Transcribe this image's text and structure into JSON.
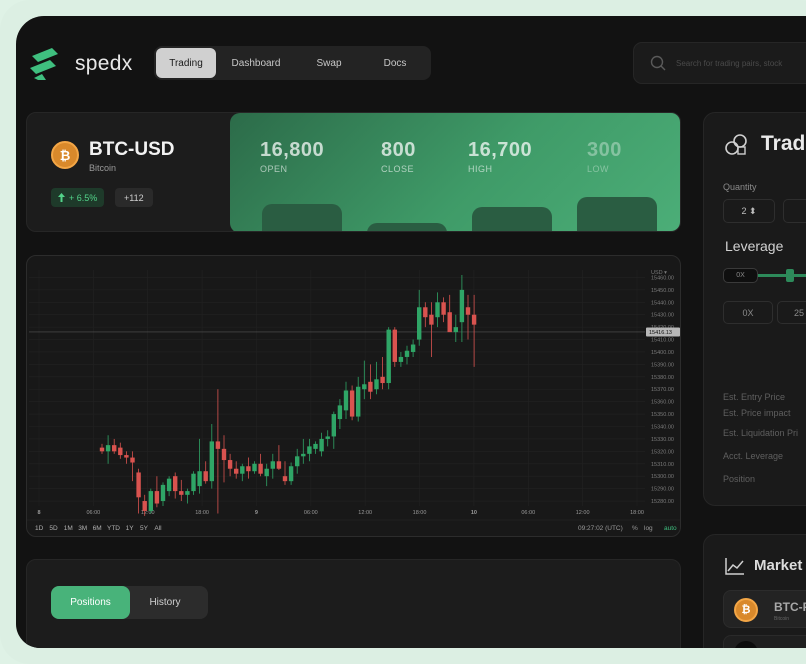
{
  "brand": {
    "name": "spedx",
    "accent": "#48b37a"
  },
  "nav": {
    "tabs": [
      "Trading",
      "Dashboard",
      "Swap",
      "Docs"
    ],
    "active": "Trading"
  },
  "search": {
    "placeholder": "Search for trading pairs, stock"
  },
  "ticker": {
    "pair": "BTC-USD",
    "name": "Bitcoin",
    "coin_symbol": "₿",
    "change": "+ 6.5%",
    "count": "+112",
    "stats": [
      {
        "value": "16,800",
        "label": "OPEN"
      },
      {
        "value": "800",
        "label": "CLOSE"
      },
      {
        "value": "16,700",
        "label": "HIGH"
      },
      {
        "value": "300",
        "label": "LOW"
      }
    ]
  },
  "chart_data": {
    "type": "candlestick",
    "currency_label": "USD ▾",
    "y_ticks": [
      15460,
      15450,
      15440,
      15430,
      15420,
      15410,
      15400,
      15390,
      15380,
      15370,
      15360,
      15350,
      15340,
      15330,
      15320,
      15310,
      15300,
      15290,
      15280
    ],
    "ylim": [
      15276,
      15466
    ],
    "x_ticks": [
      "8",
      "06:00",
      "12:00",
      "18:00",
      "9",
      "06:00",
      "12:00",
      "18:00",
      "10",
      "06:00",
      "12:00",
      "18:00"
    ],
    "last_price": "15416.13",
    "last_price_value": 15416.13,
    "ranges": [
      "1D",
      "5D",
      "1M",
      "3M",
      "6M",
      "YTD",
      "1Y",
      "5Y",
      "All"
    ],
    "clock": "09:27:02 (UTC)",
    "scale_options": [
      "%",
      "log",
      "auto"
    ],
    "colors": {
      "up": "#2fa566",
      "down": "#d9534f"
    },
    "candles": [
      {
        "o": 15323,
        "h": 15326,
        "l": 15318,
        "c": 15320
      },
      {
        "o": 15320,
        "h": 15333,
        "l": 15310,
        "c": 15325
      },
      {
        "o": 15325,
        "h": 15330,
        "l": 15318,
        "c": 15320
      },
      {
        "o": 15323,
        "h": 15327,
        "l": 15314,
        "c": 15317
      },
      {
        "o": 15317,
        "h": 15320,
        "l": 15310,
        "c": 15315
      },
      {
        "o": 15315,
        "h": 15320,
        "l": 15296,
        "c": 15311
      },
      {
        "o": 15303,
        "h": 15306,
        "l": 15270,
        "c": 15283
      },
      {
        "o": 15280,
        "h": 15285,
        "l": 15268,
        "c": 15272
      },
      {
        "o": 15272,
        "h": 15290,
        "l": 15270,
        "c": 15288
      },
      {
        "o": 15288,
        "h": 15300,
        "l": 15275,
        "c": 15278
      },
      {
        "o": 15280,
        "h": 15295,
        "l": 15276,
        "c": 15293
      },
      {
        "o": 15288,
        "h": 15300,
        "l": 15284,
        "c": 15298
      },
      {
        "o": 15300,
        "h": 15303,
        "l": 15282,
        "c": 15288
      },
      {
        "o": 15288,
        "h": 15297,
        "l": 15280,
        "c": 15285
      },
      {
        "o": 15285,
        "h": 15290,
        "l": 15278,
        "c": 15288
      },
      {
        "o": 15288,
        "h": 15304,
        "l": 15285,
        "c": 15302
      },
      {
        "o": 15292,
        "h": 15330,
        "l": 15286,
        "c": 15304
      },
      {
        "o": 15304,
        "h": 15312,
        "l": 15294,
        "c": 15296
      },
      {
        "o": 15296,
        "h": 15342,
        "l": 15290,
        "c": 15328
      },
      {
        "o": 15328,
        "h": 15370,
        "l": 15270,
        "c": 15322
      },
      {
        "o": 15322,
        "h": 15333,
        "l": 15295,
        "c": 15313
      },
      {
        "o": 15313,
        "h": 15318,
        "l": 15300,
        "c": 15306
      },
      {
        "o": 15306,
        "h": 15312,
        "l": 15298,
        "c": 15302
      },
      {
        "o": 15302,
        "h": 15310,
        "l": 15296,
        "c": 15308
      },
      {
        "o": 15308,
        "h": 15315,
        "l": 15298,
        "c": 15304
      },
      {
        "o": 15304,
        "h": 15312,
        "l": 15302,
        "c": 15310
      },
      {
        "o": 15310,
        "h": 15318,
        "l": 15300,
        "c": 15302
      },
      {
        "o": 15300,
        "h": 15310,
        "l": 15292,
        "c": 15306
      },
      {
        "o": 15306,
        "h": 15318,
        "l": 15298,
        "c": 15312
      },
      {
        "o": 15312,
        "h": 15325,
        "l": 15305,
        "c": 15306
      },
      {
        "o": 15300,
        "h": 15312,
        "l": 15293,
        "c": 15296
      },
      {
        "o": 15296,
        "h": 15311,
        "l": 15293,
        "c": 15308
      },
      {
        "o": 15308,
        "h": 15322,
        "l": 15302,
        "c": 15316
      },
      {
        "o": 15316,
        "h": 15330,
        "l": 15310,
        "c": 15318
      },
      {
        "o": 15318,
        "h": 15330,
        "l": 15312,
        "c": 15324
      },
      {
        "o": 15322,
        "h": 15328,
        "l": 15318,
        "c": 15326
      },
      {
        "o": 15320,
        "h": 15335,
        "l": 15316,
        "c": 15330
      },
      {
        "o": 15330,
        "h": 15337,
        "l": 15324,
        "c": 15332
      },
      {
        "o": 15332,
        "h": 15352,
        "l": 15322,
        "c": 15350
      },
      {
        "o": 15346,
        "h": 15362,
        "l": 15338,
        "c": 15357
      },
      {
        "o": 15353,
        "h": 15376,
        "l": 15346,
        "c": 15369
      },
      {
        "o": 15369,
        "h": 15373,
        "l": 15345,
        "c": 15348
      },
      {
        "o": 15348,
        "h": 15380,
        "l": 15344,
        "c": 15372
      },
      {
        "o": 15370,
        "h": 15393,
        "l": 15362,
        "c": 15374
      },
      {
        "o": 15376,
        "h": 15390,
        "l": 15362,
        "c": 15368
      },
      {
        "o": 15370,
        "h": 15392,
        "l": 15366,
        "c": 15378
      },
      {
        "o": 15380,
        "h": 15396,
        "l": 15370,
        "c": 15375
      },
      {
        "o": 15375,
        "h": 15420,
        "l": 15370,
        "c": 15418
      },
      {
        "o": 15418,
        "h": 15420,
        "l": 15388,
        "c": 15392
      },
      {
        "o": 15392,
        "h": 15400,
        "l": 15388,
        "c": 15396
      },
      {
        "o": 15396,
        "h": 15405,
        "l": 15390,
        "c": 15401
      },
      {
        "o": 15400,
        "h": 15410,
        "l": 15396,
        "c": 15406
      },
      {
        "o": 15410,
        "h": 15450,
        "l": 15405,
        "c": 15436
      },
      {
        "o": 15436,
        "h": 15440,
        "l": 15420,
        "c": 15428
      },
      {
        "o": 15430,
        "h": 15440,
        "l": 15396,
        "c": 15422
      },
      {
        "o": 15428,
        "h": 15448,
        "l": 15420,
        "c": 15440
      },
      {
        "o": 15440,
        "h": 15444,
        "l": 15424,
        "c": 15430
      },
      {
        "o": 15432,
        "h": 15446,
        "l": 15420,
        "c": 15416
      },
      {
        "o": 15416,
        "h": 15430,
        "l": 15408,
        "c": 15420
      },
      {
        "o": 15424,
        "h": 15462,
        "l": 15408,
        "c": 15450
      },
      {
        "o": 15436,
        "h": 15446,
        "l": 15410,
        "c": 15430
      },
      {
        "o": 15430,
        "h": 15446,
        "l": 15388,
        "c": 15422
      }
    ]
  },
  "trade": {
    "title": "Trad",
    "quantity_label": "Quantity",
    "quantity_value": "2 ⬍",
    "leverage_label": "Leverage",
    "slider_badge": "0X",
    "leverage_options": [
      "0X",
      "25"
    ],
    "est_rows": [
      "Est. Entry Price",
      "Est. Price impact",
      "Est. Liquidation Pri",
      "Acct. Leverage",
      "Position"
    ]
  },
  "positions": {
    "tabs": [
      "Positions",
      "History"
    ],
    "active": "Positions"
  },
  "market": {
    "title": "Market",
    "rows": [
      {
        "name": "BTC-F",
        "sub": "Bitcoin",
        "symbol": "₿"
      }
    ]
  }
}
